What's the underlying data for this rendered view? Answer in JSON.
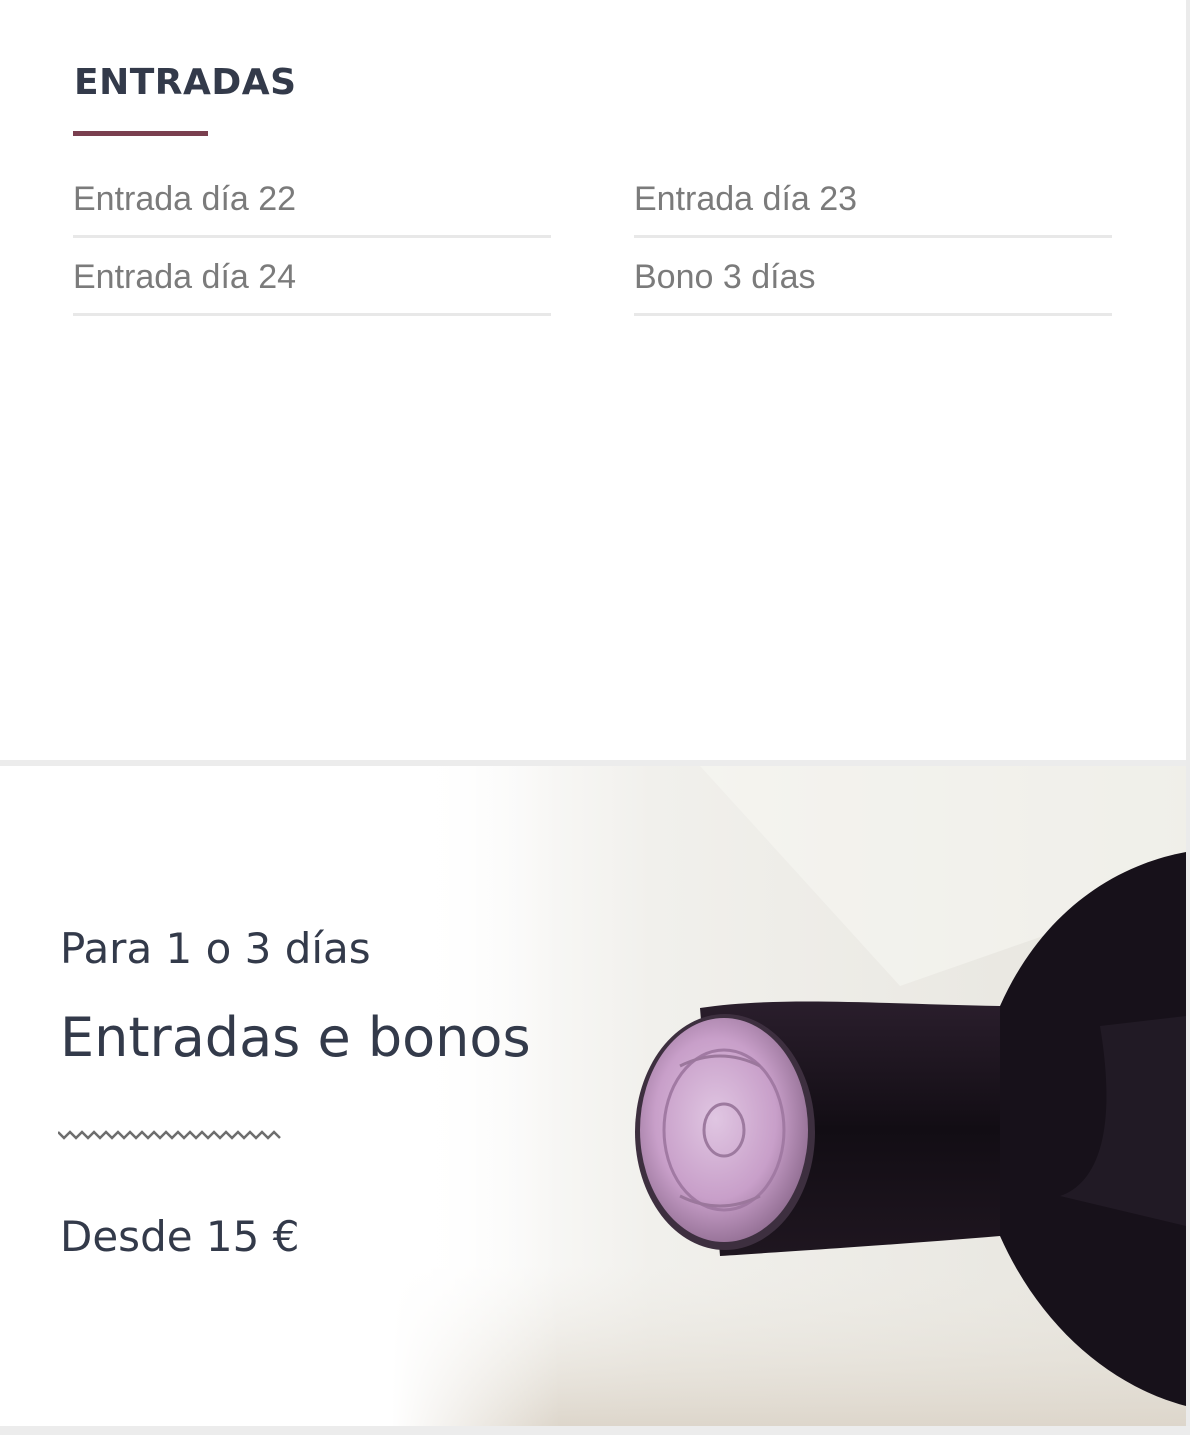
{
  "entradas": {
    "title": "ENTRADAS",
    "links": [
      {
        "label": "Entrada día 22"
      },
      {
        "label": "Entrada día 23"
      },
      {
        "label": "Entrada día 24"
      },
      {
        "label": "Bono 3 días"
      }
    ]
  },
  "banner": {
    "subtitle": "Para 1 o 3 días",
    "title": "Entradas e bonos",
    "price": "Desde 15 €",
    "image_icon": "wine-bottle-photo",
    "divider_icon": "zigzag-divider-icon"
  },
  "colors": {
    "heading": "#333a4a",
    "accent": "#7a3f4f",
    "link_text": "#7b7b7b",
    "rule": "#e8e8e8"
  }
}
